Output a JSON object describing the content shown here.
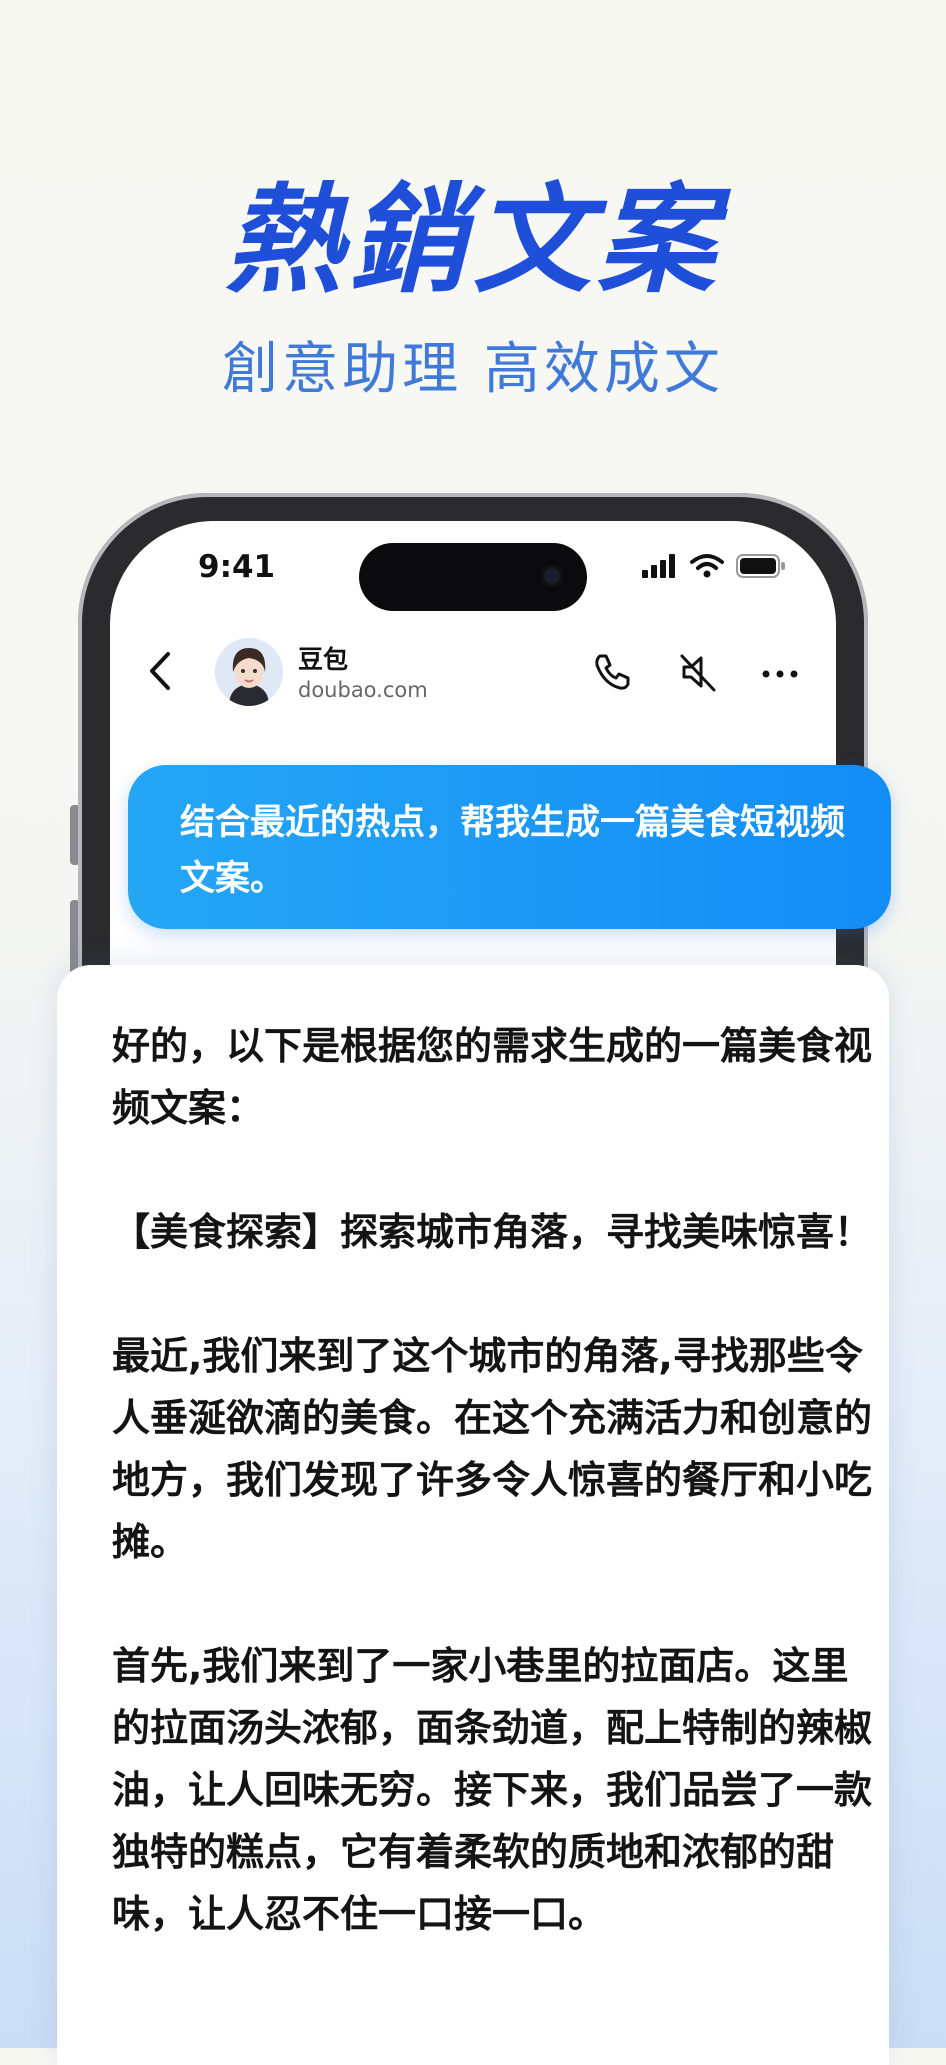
{
  "hero": {
    "title": "熱銷文案",
    "subtitle": "創意助理 高效成文"
  },
  "status_bar": {
    "time": "9:41"
  },
  "chat_header": {
    "bot_name": "豆包",
    "bot_domain": "doubao.com",
    "icons": [
      "back-arrow-icon",
      "phone-icon",
      "mute-icon",
      "more-icon"
    ]
  },
  "user_message": "结合最近的热点，帮我生成一篇美食短视频文案。",
  "reply": {
    "paragraphs": [
      "好的，以下是根据您的需求生成的一篇美食视频文案：",
      "【美食探索】探索城市角落，寻找美味惊喜！",
      "最近,我们来到了这个城市的角落,寻找那些令人垂涎欲滴的美食。在这个充满活力和创意的地方，我们发现了许多令人惊喜的餐厅和小吃摊。",
      "首先,我们来到了一家小巷里的拉面店。这里的拉面汤头浓郁，面条劲道，配上特制的辣椒油，让人回味无穷。接下来，我们品尝了一款独特的糕点，它有着柔软的质地和浓郁的甜味，让人忍不住一口接一口。"
    ]
  },
  "colors": {
    "title_blue": "#1f4fd8",
    "subtitle_blue": "#3f7ad8",
    "bubble_start": "#25a6f5",
    "bubble_end": "#138df6"
  }
}
